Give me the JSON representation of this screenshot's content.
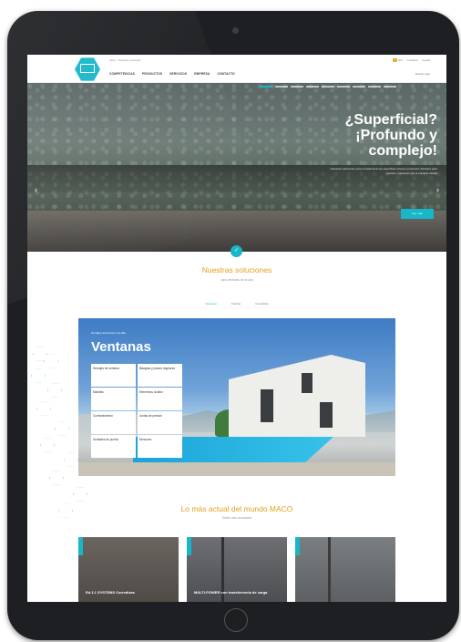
{
  "header": {
    "breadcrumb": "Inicio · Nuestros ventanas",
    "nav": [
      "COMPETENCIAS",
      "PRODUCTOS",
      "SERVICIOS",
      "EMPRESA",
      "CONTACTO"
    ],
    "lang_links": [
      "ES",
      "Contacto",
      "Ayuda"
    ],
    "search_label": "Buscar aquí"
  },
  "hero": {
    "title": "¿Superficial? ¡Profundo y complejo!",
    "text": "Nuestras soluciones para el tratamiento de superficies ofrecen protección duradera para puertas y ventanas con la máxima calidad",
    "button": "leer más",
    "prev": "‹",
    "next": "›"
  },
  "solutions": {
    "title": "Nuestras soluciones",
    "subtitle": "para ventanas de la vida",
    "tabs": [
      "Ventanas",
      "Puertas",
      "Corredizas"
    ]
  },
  "window_section": {
    "small_label": "Herrajes de la línea y la vida",
    "title": "Ventanas",
    "items": [
      "Herrajes de ventana",
      "Bisagras y planos regulares",
      "Manillas",
      "Elementos ocultos",
      "Confortamiento",
      "Juntas de presión",
      "Unidades de puerta",
      "Sensores"
    ]
  },
  "news": {
    "title": "Lo más actual del mundo MACO",
    "subtitle": "Desde más novedades",
    "cards": [
      "Ed.1.1 SYSTEMS Corredizas",
      "MULTI-POWER con transferencia de carga",
      ""
    ]
  },
  "colors": {
    "accent": "#17b6c9",
    "headline": "#e3a020"
  }
}
